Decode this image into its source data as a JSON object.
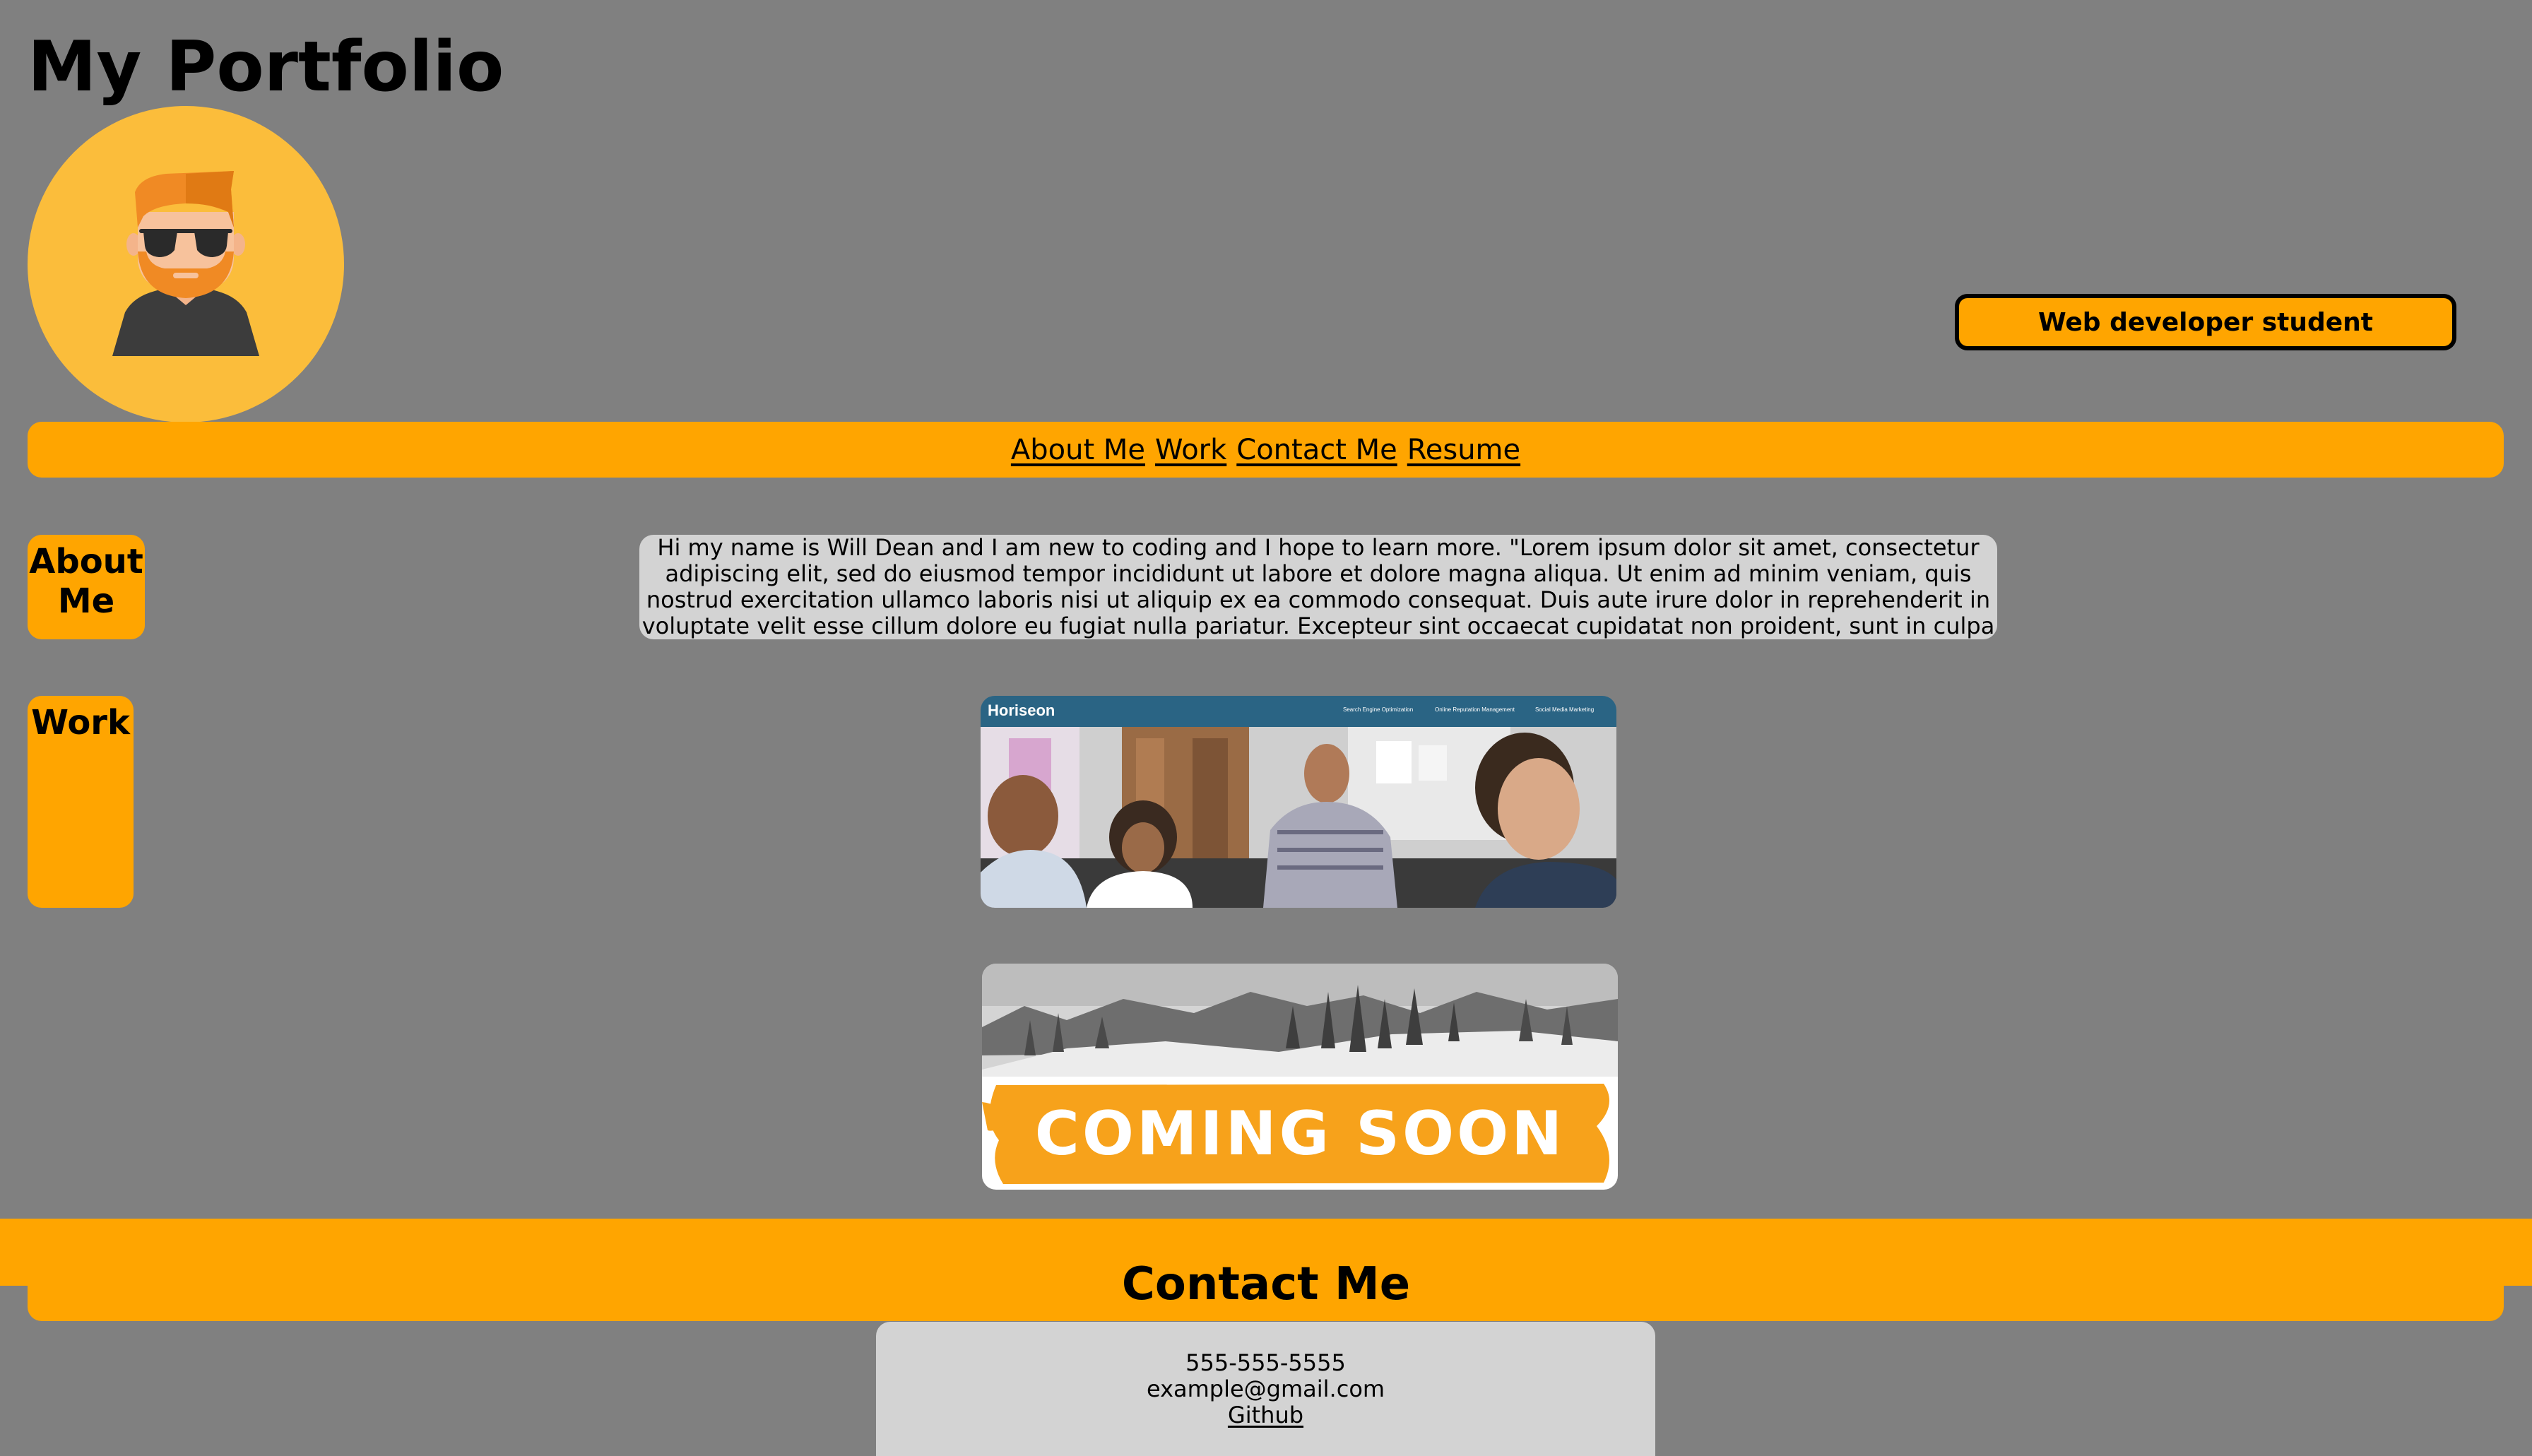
{
  "header": {
    "title": "My Portfolio",
    "role": "Web developer student"
  },
  "avatar": {
    "icon": "person-with-sunglasses-icon",
    "background": "#fbbd3b",
    "hair": "#f08a24",
    "shirt": "#3c3c3c"
  },
  "nav": {
    "items": [
      {
        "label": "About Me"
      },
      {
        "label": "Work"
      },
      {
        "label": "Contact Me"
      },
      {
        "label": "Resume"
      }
    ]
  },
  "sections": {
    "about_label": "About Me",
    "work_label": "Work",
    "about_text": "Hi my name is Will Dean and I am new to coding and I hope to learn more. \"Lorem ipsum dolor sit amet, consectetur adipiscing elit, sed do eiusmod tempor incididunt ut labore et dolore magna aliqua. Ut enim ad minim veniam, quis nostrud exercitation ullamco laboris nisi ut aliquip ex ea commodo consequat. Duis aute irure dolor in reprehenderit in voluptate velit esse cillum dolore eu fugiat nulla pariatur. Excepteur sint occaecat cupidatat non proident, sunt in culpa qui officia deserunt mollit anim id est laborum.\""
  },
  "projects": [
    {
      "brand": "Horiseon",
      "nav_links": [
        "Search Engine Optimization",
        "Online Reputation Management",
        "Social Media Marketing"
      ]
    },
    {
      "banner": "COMING SOON"
    }
  ],
  "contact": {
    "heading": "Contact Me",
    "phone": "555-555-5555",
    "email": "example@gmail.com",
    "github": "Github"
  },
  "colors": {
    "page_background": "#808080",
    "accent": "#ffa500",
    "panel": "#d3d3d3",
    "horiseon_header": "#2a6484"
  }
}
